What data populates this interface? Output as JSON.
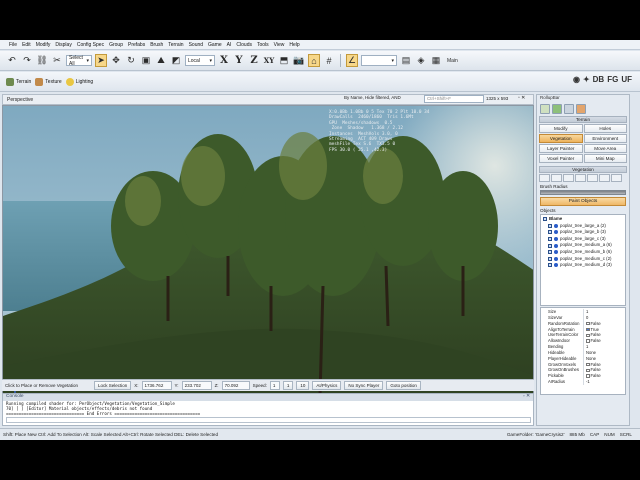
{
  "menu": [
    "File",
    "Edit",
    "Modify",
    "Display",
    "Config Spec",
    "Group",
    "Prefabs",
    "Brush",
    "Terrain",
    "Sound",
    "Game",
    "AI",
    "Clouds",
    "Tools",
    "View",
    "Help"
  ],
  "toolbar": {
    "select_mode": "Select All",
    "coord_space": "Local",
    "axes": [
      "X",
      "Y",
      "Z",
      "XY"
    ],
    "main_label": "Main"
  },
  "toolbar2": {
    "terrain": "Terrain",
    "texture": "Texture",
    "lighting": "Lighting",
    "right_icons": [
      "DB",
      "FG",
      "UF"
    ]
  },
  "viewport": {
    "title": "Perspective",
    "filter": "By Name, Hide filtered, AND",
    "search_placeholder": "Ctrl+Shift+F",
    "resolution": "1325 x 593"
  },
  "stats_overlay": "X:0.0Bb 1.0Bb 0 5 Tex 70 2 Plt 10.0 34  \nDrawCalls  2460/1860  Tris 1.6Mt  \nGPU  Meshes/shadows  0.5\n Zone  Shadow   1.368 / 2.12\nInstances  MeshVols 3.0, 0  \nStreaming  ACT 409 Draws  \nmeshFile Tex S.6  TX3.5 0\nFPS 30.0 ( 25.1 ,42.3)",
  "status_row": {
    "hint": "Click to Place or Remove Vegetation",
    "lock_label": "Lock Selection",
    "x_label": "X:",
    "x_value": "1736.762",
    "y_label": "Y:",
    "y_value": "233.702",
    "z_label": "Z:",
    "z_value": "70.092",
    "speed_label": "Speed:",
    "speed_value": "1",
    "speed_opts": [
      "1",
      "10"
    ],
    "ai_physics": "AI/Physics",
    "no_sync": "No Sync Player",
    "goto": "Goto position"
  },
  "console": {
    "title": "Console",
    "lines": [
      "Running compiled shader for: PerObject/Vegetation/Vegetation_Simple",
      "70] [ ] [Editor]   Material objects/effects/debris not found",
      "=============================== End Errors =================================="
    ]
  },
  "statusbar": {
    "text": "Shift: Place New   Ctrl: Add To Selection   Alt: Scale Selected   Alt+Ctrl: Rotate Selected   DEL: Delete Selected",
    "game_folder": "GameFolder: 'GameCrysis2'",
    "memory": "885 Mb",
    "caps": "CAP",
    "num": "NUM",
    "scrl": "SCRL"
  },
  "rollup": {
    "title": "RollupBar",
    "terrain_head": "Terrain",
    "buttons": [
      {
        "label": "Modify",
        "active": false
      },
      {
        "label": "Holes",
        "active": false
      },
      {
        "label": "Vegetation",
        "active": true
      },
      {
        "label": "Environment",
        "active": false
      },
      {
        "label": "Layer Painter",
        "active": false
      },
      {
        "label": "Move Area",
        "active": false
      },
      {
        "label": "Voxel Painter",
        "active": false
      },
      {
        "label": "Mini Map",
        "active": false
      }
    ],
    "vegetation_head": "Vegetation",
    "brush_radius": "Brush Radius",
    "paint_objects": "Paint Objects",
    "objects_label": "Objects",
    "objects": {
      "root": "Blame",
      "items": [
        "poplar_tree_large_a (2)",
        "poplar_tree_large_b (3)",
        "poplar_tree_large_c (3)",
        "poplar_tree_medium_a (6)",
        "poplar_tree_medium_b (6)",
        "poplar_tree_medium_c (2)",
        "poplar_tree_medium_d (3)"
      ]
    },
    "properties": [
      {
        "name": "Size",
        "value": "1"
      },
      {
        "name": "SizeVar",
        "value": "0"
      },
      {
        "name": "RandomRotation",
        "value": "False"
      },
      {
        "name": "AlignToTerrain",
        "value": "True"
      },
      {
        "name": "UseTerrainColor",
        "value": "False"
      },
      {
        "name": "AllowIndoor",
        "value": "False"
      },
      {
        "name": "Bending",
        "value": "1"
      },
      {
        "name": "Hideable",
        "value": "None"
      },
      {
        "name": "PlayerHideable",
        "value": "None"
      },
      {
        "name": "GrowOnVoxels",
        "value": "False"
      },
      {
        "name": "GrowOnBrushes",
        "value": "False"
      },
      {
        "name": "Pickable",
        "value": "False"
      },
      {
        "name": "AIRadius",
        "value": "-1"
      }
    ]
  },
  "colors": {
    "active_button": "#eeb35c",
    "panel_bg": "#e4eaf1",
    "sky": "#8fb6c8",
    "grass": "#3a4d2c"
  }
}
